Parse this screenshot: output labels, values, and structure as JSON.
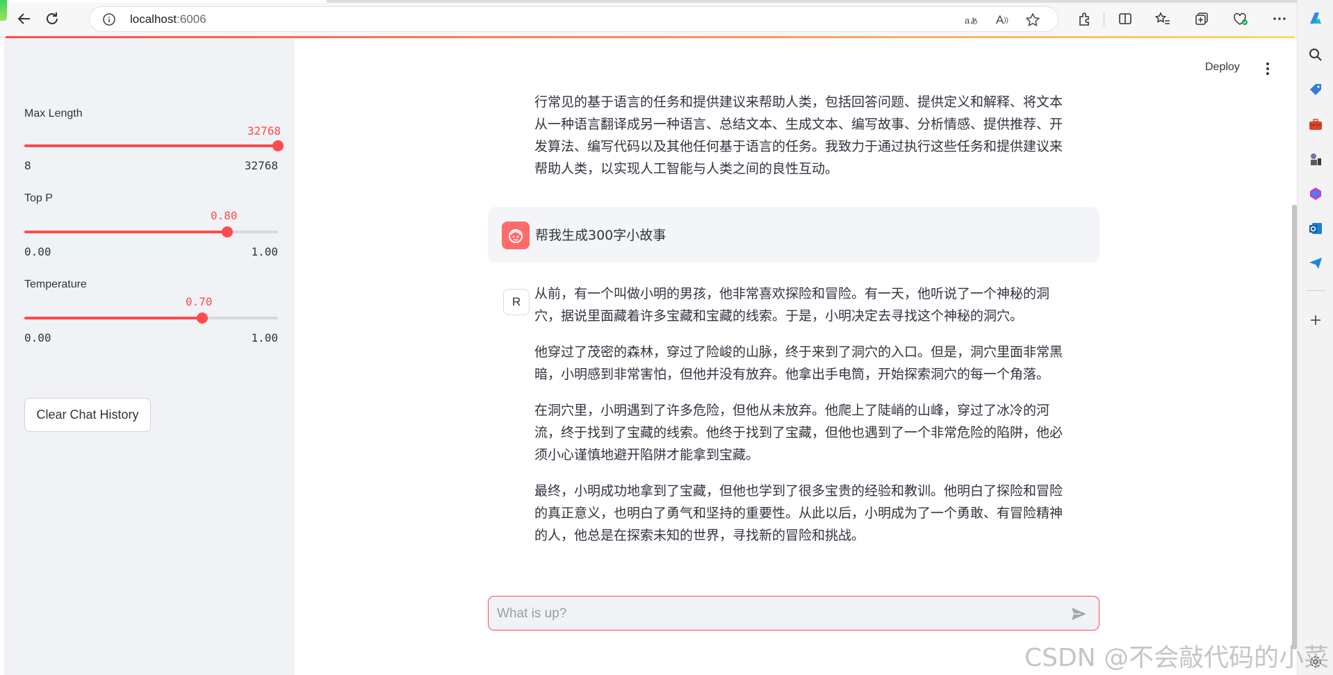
{
  "browser": {
    "url_host": "localhost",
    "url_port": ":6006",
    "read_aloud_label": "A"
  },
  "header": {
    "deploy_label": "Deploy"
  },
  "sidebar": {
    "sliders": [
      {
        "label": "Max Length",
        "value": "32768",
        "min": "8",
        "max": "32768",
        "fraction": 1.0
      },
      {
        "label": "Top P",
        "value": "0.80",
        "min": "0.00",
        "max": "1.00",
        "fraction": 0.8
      },
      {
        "label": "Temperature",
        "value": "0.70",
        "min": "0.00",
        "max": "1.00",
        "fraction": 0.7
      }
    ],
    "clear_button_label": "Clear Chat History"
  },
  "chat": {
    "assistant_intro_lines": [
      "行常见的基于语言的任务和提供建议来帮助人类，包括回答问题、提供定义和解释、将文本",
      "从一种语言翻译成另一种语言、总结文本、生成文本、编写故事、分析情感、提供推荐、开",
      "发算法、编写代码以及其他任何基于语言的任务。我致力于通过执行这些任务和提供建议来",
      "帮助人类，以实现人工智能与人类之间的良性互动。"
    ],
    "user_message": "帮我生成300字小故事",
    "assistant_avatar_letter": "R",
    "story_paragraphs": [
      [
        "从前，有一个叫做小明的男孩，他非常喜欢探险和冒险。有一天，他听说了一个神秘的洞",
        "穴，据说里面藏着许多宝藏和宝藏的线索。于是，小明决定去寻找这个神秘的洞穴。"
      ],
      [
        "他穿过了茂密的森林，穿过了险峻的山脉，终于来到了洞穴的入口。但是，洞穴里面非常黑",
        "暗，小明感到非常害怕，但他并没有放弃。他拿出手电筒，开始探索洞穴的每一个角落。"
      ],
      [
        "在洞穴里，小明遇到了许多危险，但他从未放弃。他爬上了陡峭的山峰，穿过了冰冷的河",
        "流，终于找到了宝藏的线索。他终于找到了宝藏，但他也遇到了一个非常危险的陷阱，他必",
        "须小心谨慎地避开陷阱才能拿到宝藏。"
      ],
      [
        "最终，小明成功地拿到了宝藏，但他也学到了很多宝贵的经验和教训。他明白了探险和冒险",
        "的真正意义，也明白了勇气和坚持的重要性。从此以后，小明成为了一个勇敢、有冒险精神",
        "的人，他总是在探索未知的世界，寻找新的冒险和挑战。"
      ]
    ],
    "input_placeholder": "What is up?"
  },
  "watermark": "CSDN @不会敲代码的小菜",
  "colors": {
    "accent": "#ff4b4b",
    "sidebar_bg": "#f0f2f6",
    "text": "#31333f"
  }
}
